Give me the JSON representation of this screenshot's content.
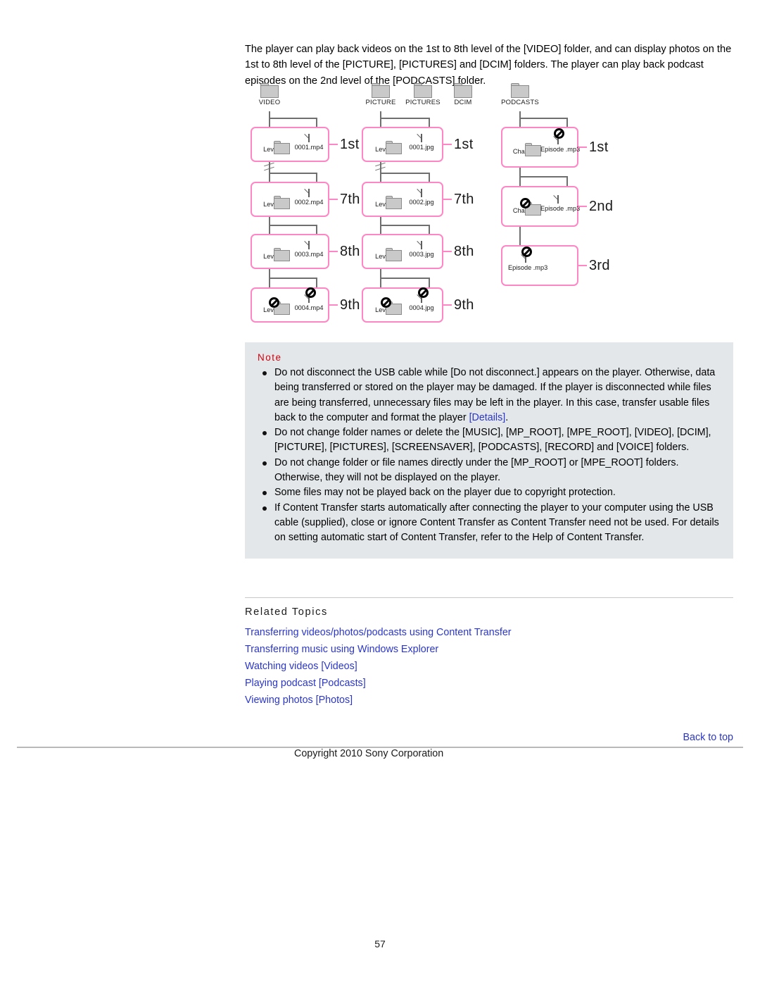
{
  "intro": {
    "paragraph": "The player can play back videos on the 1st to 8th level of the [VIDEO] folder, and can display photos on the 1st to 8th level of the [PICTURE], [PICTURES] and [DCIM] folders. The player can play back podcast episodes on the 2nd level of the [PODCASTS] folder."
  },
  "diagram": {
    "accent_color": "#ff86c4",
    "columns": [
      {
        "id": "video",
        "roots": [
          "VIDEO"
        ],
        "levels": [
          {
            "tag": "1st",
            "items": [
              {
                "type": "folder",
                "caption": "Level 1",
                "blocked": false
              },
              {
                "type": "file",
                "caption": "0001.mp4",
                "blocked": false
              }
            ]
          },
          {
            "tag": "7th",
            "items": [
              {
                "type": "folder",
                "caption": "Level 7",
                "blocked": false
              },
              {
                "type": "file",
                "caption": "0002.mp4",
                "blocked": false
              }
            ]
          },
          {
            "tag": "8th",
            "items": [
              {
                "type": "folder",
                "caption": "Level 8",
                "blocked": false
              },
              {
                "type": "file",
                "caption": "0003.mp4",
                "blocked": false
              }
            ]
          },
          {
            "tag": "9th",
            "items": [
              {
                "type": "folder",
                "caption": "Level 9",
                "blocked": true
              },
              {
                "type": "file",
                "caption": "0004.mp4",
                "blocked": true
              }
            ]
          }
        ]
      },
      {
        "id": "picture",
        "roots": [
          "PICTURE",
          "PICTURES",
          "DCIM"
        ],
        "levels": [
          {
            "tag": "1st",
            "items": [
              {
                "type": "folder",
                "caption": "Level 1",
                "blocked": false
              },
              {
                "type": "file",
                "caption": "0001.jpg",
                "blocked": false
              }
            ]
          },
          {
            "tag": "7th",
            "items": [
              {
                "type": "folder",
                "caption": "Level 7",
                "blocked": false
              },
              {
                "type": "file",
                "caption": "0002.jpg",
                "blocked": false
              }
            ]
          },
          {
            "tag": "8th",
            "items": [
              {
                "type": "folder",
                "caption": "Level 8",
                "blocked": false
              },
              {
                "type": "file",
                "caption": "0003.jpg",
                "blocked": false
              }
            ]
          },
          {
            "tag": "9th",
            "items": [
              {
                "type": "folder",
                "caption": "Level 9",
                "blocked": true
              },
              {
                "type": "file",
                "caption": "0004.jpg",
                "blocked": true
              }
            ]
          }
        ]
      },
      {
        "id": "podcasts",
        "roots": [
          "PODCASTS"
        ],
        "levels": [
          {
            "tag": "1st",
            "items": [
              {
                "type": "folder",
                "caption": "Channel",
                "blocked": false
              },
              {
                "type": "file",
                "caption": "Episode\n.mp3",
                "blocked": true
              }
            ]
          },
          {
            "tag": "2nd",
            "items": [
              {
                "type": "folder",
                "caption": "Channel",
                "blocked": true
              },
              {
                "type": "file",
                "caption": "Episode\n.mp3",
                "blocked": false
              }
            ]
          },
          {
            "tag": "3rd",
            "items": [
              {
                "type": "file",
                "caption": "Episode\n.mp3",
                "blocked": true
              }
            ]
          }
        ]
      }
    ],
    "labels": {
      "video_root": "VIDEO",
      "picture_root": "PICTURE",
      "pictures_root": "PICTURES",
      "dcim_root": "DCIM",
      "podcasts_root": "PODCASTS",
      "v1_folder": "Level 1",
      "v1_file": "0001.mp4",
      "v7_folder": "Level 7",
      "v7_file": "0002.mp4",
      "v8_folder": "Level 8",
      "v8_file": "0003.mp4",
      "v9_folder": "Level 9",
      "v9_file": "0004.mp4",
      "p1_folder": "Level 1",
      "p1_file": "0001.jpg",
      "p7_folder": "Level 7",
      "p7_file": "0002.jpg",
      "p8_folder": "Level 8",
      "p8_file": "0003.jpg",
      "p9_folder": "Level 9",
      "p9_file": "0004.jpg",
      "pc1_folder": "Channel",
      "pc1_file": "Episode .mp3",
      "pc2_folder": "Channel",
      "pc2_file": "Episode .mp3",
      "pc3_file": "Episode .mp3",
      "tag_1st": "1st",
      "tag_7th": "7th",
      "tag_8th": "8th",
      "tag_9th": "9th",
      "tag_p1st": "1st",
      "tag_p7th": "7th",
      "tag_p8th": "8th",
      "tag_p9th": "9th",
      "tag_pc1st": "1st",
      "tag_pc2nd": "2nd",
      "tag_pc3rd": "3rd"
    }
  },
  "note": {
    "title": "Note",
    "title_color": "#d4000c",
    "background_color": "#e3e7ea",
    "items": [
      {
        "text_before": "Do not disconnect the USB cable while [Do not disconnect.] appears on the player. Otherwise, data being transferred or stored on the player may be damaged. If the player is disconnected while files are being transferred, unnecessary files may be left in the player. In this case, transfer usable files back to the computer and format the player ",
        "link": "[Details]",
        "text_after": "."
      },
      {
        "text_before": "Do not change folder names or delete the [MUSIC], [MP_ROOT], [MPE_ROOT], [VIDEO], [DCIM], [PICTURE], [PICTURES], [SCREENSAVER], [PODCASTS], [RECORD] and [VOICE] folders.",
        "link": "",
        "text_after": ""
      },
      {
        "text_before": "Do not change folder or file names directly under the [MP_ROOT] or [MPE_ROOT] folders. Otherwise, they will not be displayed on the player.",
        "link": "",
        "text_after": ""
      },
      {
        "text_before": "Some files may not be played back on the player due to copyright protection.",
        "link": "",
        "text_after": ""
      },
      {
        "text_before": "If Content Transfer starts automatically after connecting the player to your computer using the USB cable (supplied), close or ignore Content Transfer as Content Transfer need not be used. For details on setting automatic start of Content Transfer, refer to the Help of Content Transfer.",
        "link": "",
        "text_after": ""
      }
    ]
  },
  "related_topics": {
    "title": "Related Topics",
    "link_color": "#2b36c8",
    "links": [
      "Transferring videos/photos/podcasts using Content Transfer",
      "Transferring music using Windows Explorer",
      "Watching videos [Videos]",
      "Playing podcast [Podcasts]",
      "Viewing photos [Photos]"
    ]
  },
  "footer": {
    "back_to_top": "Back to top",
    "copyright": "Copyright 2010 Sony Corporation",
    "page_number": "57"
  }
}
